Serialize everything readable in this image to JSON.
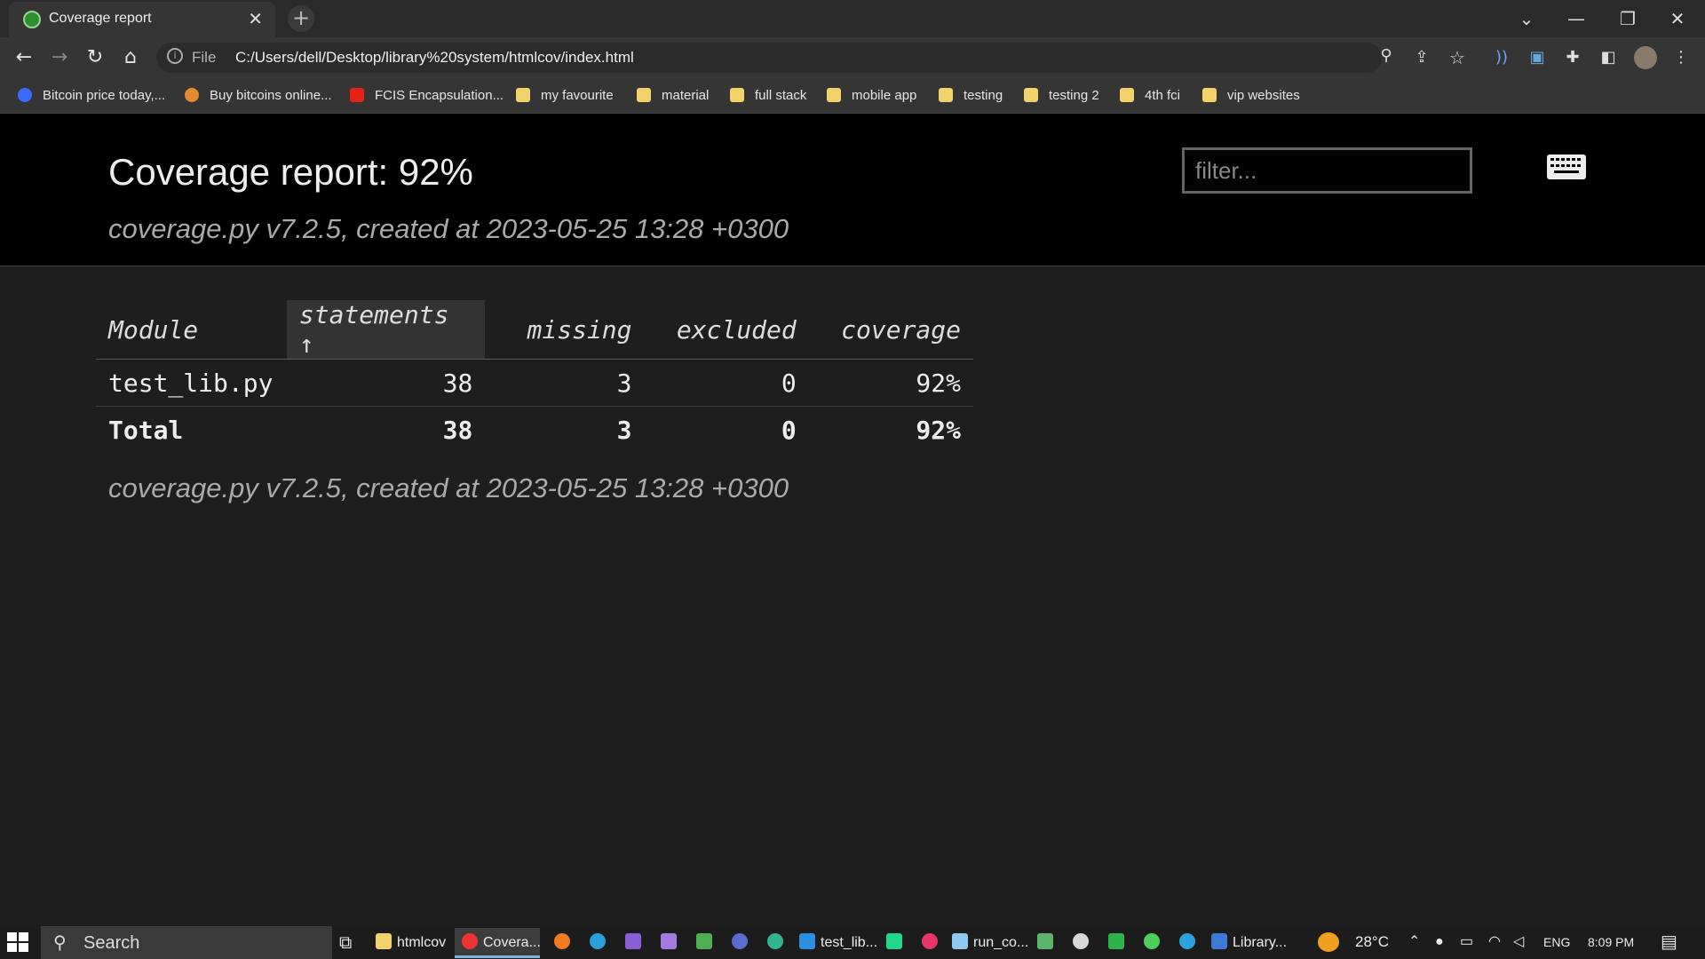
{
  "browser": {
    "tab_title": "Coverage report",
    "url_scheme": "File",
    "url": "C:/Users/dell/Desktop/library%20system/htmlcov/index.html",
    "bookmarks": [
      {
        "label": "Bitcoin price today,...",
        "icon": "blue-circle-icon"
      },
      {
        "label": "Buy bitcoins online...",
        "icon": "bitcoin-icon"
      },
      {
        "label": "FCIS Encapsulation...",
        "icon": "youtube-icon"
      },
      {
        "label": "my favourite",
        "icon": "folder-icon"
      },
      {
        "label": "material",
        "icon": "folder-icon"
      },
      {
        "label": "full stack",
        "icon": "folder-icon"
      },
      {
        "label": "mobile app",
        "icon": "folder-icon"
      },
      {
        "label": "testing",
        "icon": "folder-icon"
      },
      {
        "label": "testing 2",
        "icon": "folder-icon"
      },
      {
        "label": "4th fci",
        "icon": "folder-icon"
      },
      {
        "label": "vip websites",
        "icon": "folder-icon"
      }
    ]
  },
  "report": {
    "title": "Coverage report: 92%",
    "created": "coverage.py v7.2.5, created at 2023-05-25 13:28 +0300",
    "filter_placeholder": "filter...",
    "columns": [
      "Module",
      "statements ↑",
      "missing",
      "excluded",
      "coverage"
    ],
    "rows": [
      {
        "module": "test_lib.py",
        "statements": "38",
        "missing": "3",
        "excluded": "0",
        "coverage": "92%"
      }
    ],
    "total": {
      "module": "Total",
      "statements": "38",
      "missing": "3",
      "excluded": "0",
      "coverage": "92%"
    }
  },
  "taskbar": {
    "search_label": "Search",
    "items": [
      {
        "label": "htmlcov"
      },
      {
        "label": "Covera..."
      },
      {
        "label": "test_lib..."
      },
      {
        "label": "run_co..."
      },
      {
        "label": "Library..."
      }
    ],
    "weather": "28°C",
    "language": "ENG",
    "time": "8:09 PM"
  }
}
